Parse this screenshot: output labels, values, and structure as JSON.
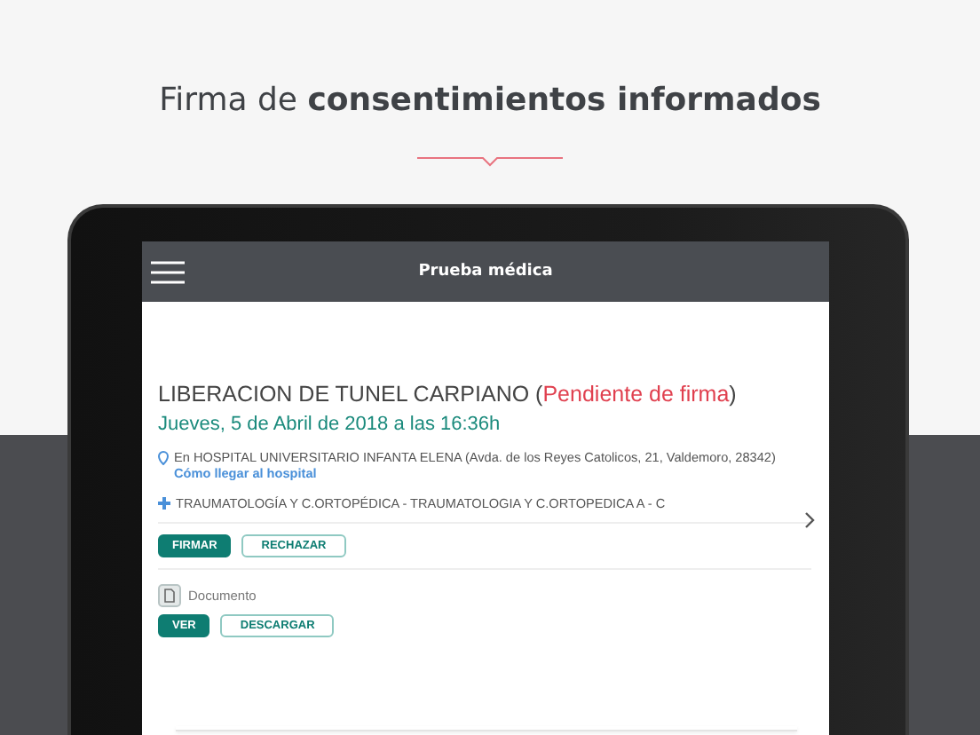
{
  "headline": "Firma de **consentimientos informados**",
  "app": {
    "title": "Prueba médica"
  },
  "procedure": {
    "name": "LIBERACION DE TUNEL CARPIANO",
    "status_open": "(",
    "status": "Pendiente de firma",
    "status_close": ")",
    "date": "Jueves, 5 de Abril de 2018 a las 16:36h",
    "location": "En HOSPITAL UNIVERSITARIO INFANTA ELENA (Avda. de los Reyes Catolicos, 21, Valdemoro, 28342)",
    "location_link": "Cómo llegar al hospital",
    "specialty": "TRAUMATOLOGÍA Y C.ORTOPÉDICA - TRAUMATOLOGIA Y C.ORTOPEDICA A - C"
  },
  "actions": [
    {
      "label": "FIRMAR",
      "kind": "primary"
    },
    {
      "label": "RECHAZAR",
      "kind": "outline"
    }
  ],
  "document": {
    "label": "Documento",
    "actions": [
      {
        "label": "VER",
        "kind": "primary"
      },
      {
        "label": "DESCARGAR",
        "kind": "outline"
      }
    ]
  }
}
